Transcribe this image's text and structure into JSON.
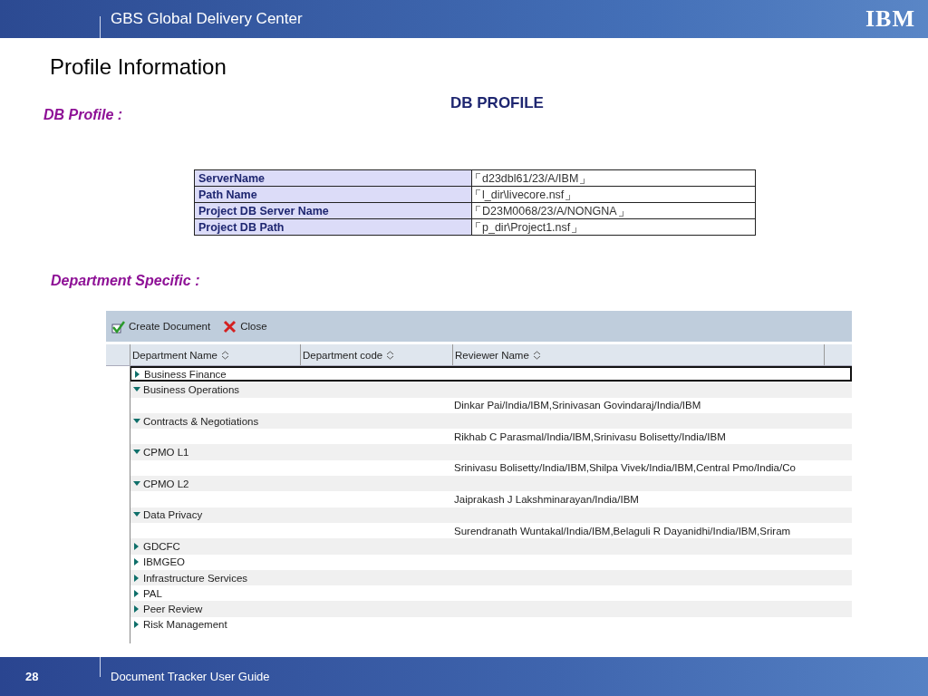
{
  "header": {
    "title": "GBS Global Delivery Center",
    "logo": "IBM"
  },
  "page_title": "Profile Information",
  "db_profile": {
    "section_label": "DB Profile :",
    "heading": "DB PROFILE",
    "rows": [
      {
        "label": "ServerName",
        "value": "d23dbl61/23/A/IBM"
      },
      {
        "label": "Path Name",
        "value": "l_dir\\livecore.nsf"
      },
      {
        "label": "Project DB Server Name",
        "value": "D23M0068/23/A/NONGNA"
      },
      {
        "label": "Project DB Path",
        "value": "p_dir\\Project1.nsf"
      }
    ]
  },
  "department_section": {
    "section_label": "Department Specific :"
  },
  "view": {
    "toolbar": [
      {
        "kind": "create",
        "label": "Create Document"
      },
      {
        "kind": "close",
        "label": "Close"
      }
    ],
    "columns": [
      "Department Name",
      "Department code",
      "Reviewer Name"
    ],
    "rows": [
      {
        "name": "Business Finance",
        "expanded": false,
        "selected": true
      },
      {
        "name": "Business Operations",
        "expanded": true,
        "selected": false,
        "children": [
          {
            "reviewer": "Dinkar Pai/India/IBM,Srinivasan Govindaraj/India/IBM"
          }
        ]
      },
      {
        "name": "Contracts & Negotiations",
        "expanded": true,
        "selected": false,
        "children": [
          {
            "reviewer": "Rikhab C Parasmal/India/IBM,Srinivasu Bolisetty/India/IBM"
          }
        ]
      },
      {
        "name": "CPMO L1",
        "expanded": true,
        "selected": false,
        "children": [
          {
            "reviewer": "Srinivasu Bolisetty/India/IBM,Shilpa Vivek/India/IBM,Central Pmo/India/Co"
          }
        ]
      },
      {
        "name": "CPMO L2",
        "expanded": true,
        "selected": false,
        "children": [
          {
            "reviewer": "Jaiprakash J Lakshminarayan/India/IBM"
          }
        ]
      },
      {
        "name": "Data Privacy",
        "expanded": true,
        "selected": false,
        "children": [
          {
            "reviewer": "Surendranath Wuntakal/India/IBM,Belaguli R Dayanidhi/India/IBM,Sriram"
          }
        ]
      },
      {
        "name": "GDCFC",
        "expanded": false,
        "selected": false
      },
      {
        "name": "IBMGEO",
        "expanded": false,
        "selected": false
      },
      {
        "name": "Infrastructure Services",
        "expanded": false,
        "selected": false
      },
      {
        "name": "PAL",
        "expanded": false,
        "selected": false
      },
      {
        "name": "Peer Review",
        "expanded": false,
        "selected": false
      },
      {
        "name": "Risk Management",
        "expanded": false,
        "selected": false
      }
    ]
  },
  "footer": {
    "page_number": "28",
    "title": "Document Tracker User Guide"
  }
}
